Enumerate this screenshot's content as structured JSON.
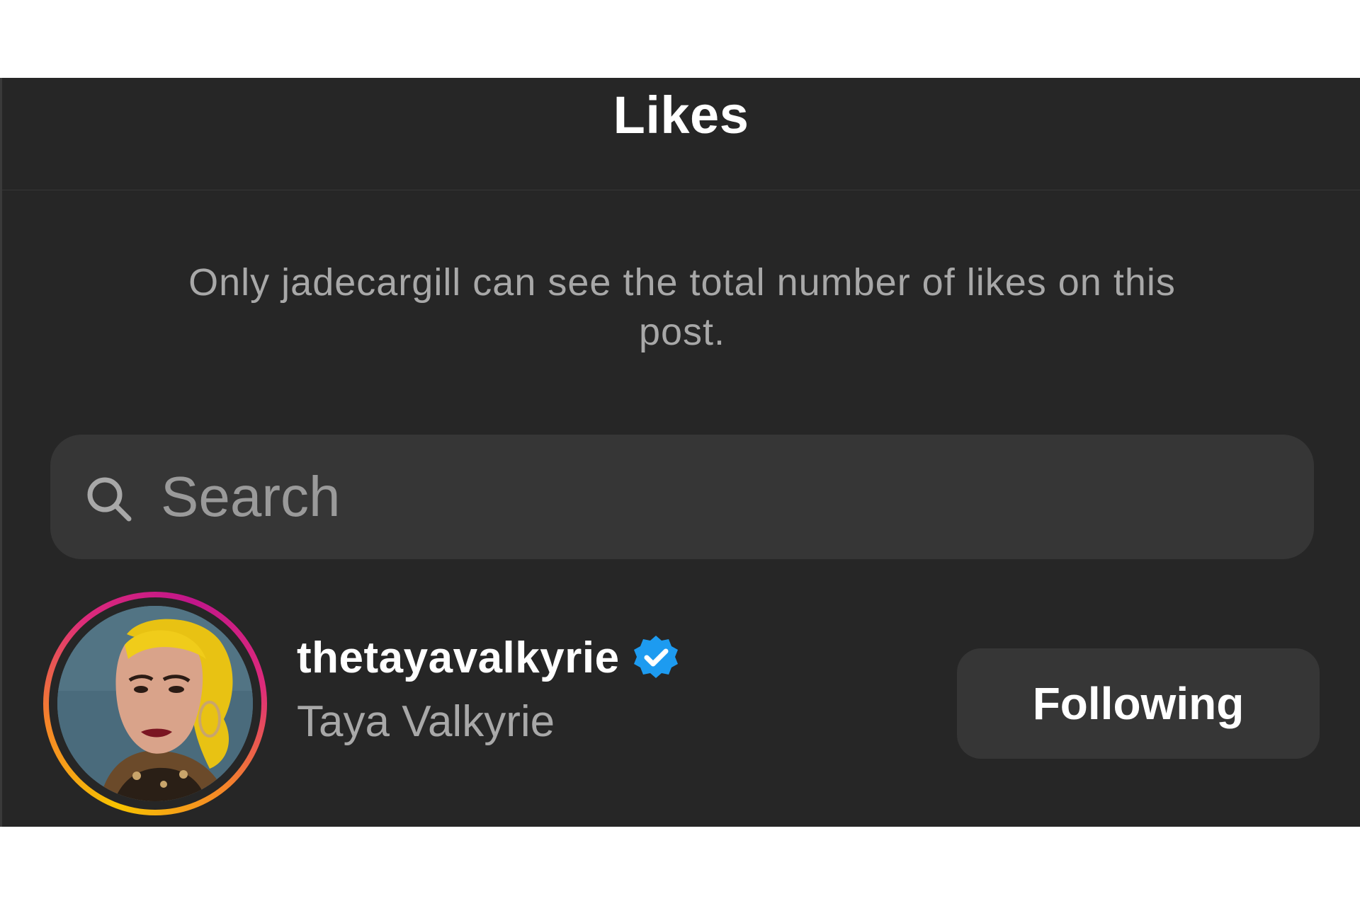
{
  "header": {
    "title": "Likes"
  },
  "notice": {
    "text": "Only jadecargill can see the total number of likes on this post."
  },
  "search": {
    "placeholder": "Search",
    "value": ""
  },
  "likes_list": [
    {
      "username": "thetayavalkyrie",
      "full_name": "Taya Valkyrie",
      "verified": true,
      "has_story_ring": true,
      "button_label": "Following"
    }
  ],
  "icons": {
    "search": "search-icon",
    "verified": "verified-badge-icon"
  },
  "colors": {
    "background": "#262626",
    "surface": "#363636",
    "text_primary": "#ffffff",
    "text_secondary": "#a8a8a8",
    "verified_blue": "#1d9bf0",
    "story_ring": [
      "#f7c300",
      "#f58529",
      "#dd2a7b",
      "#c1168a"
    ]
  }
}
